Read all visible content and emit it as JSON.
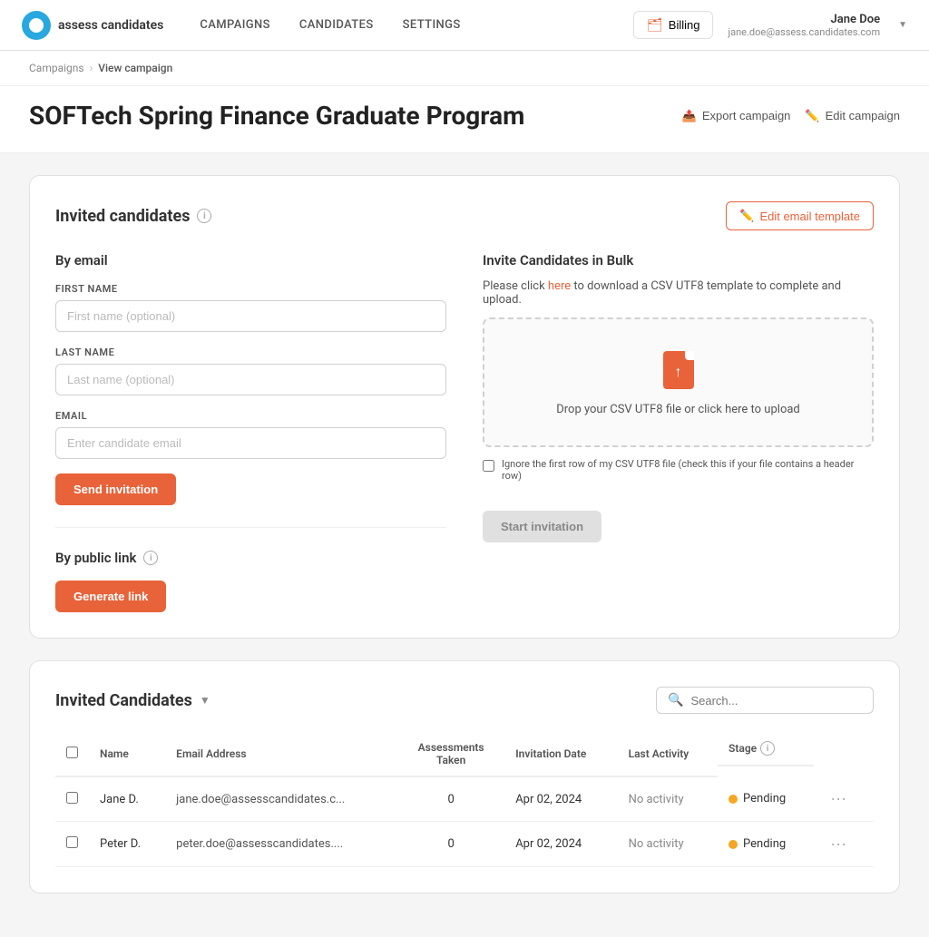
{
  "app": {
    "name": "assess candidates",
    "logo_alt": "assess candidates logo"
  },
  "nav": {
    "links": [
      {
        "label": "CAMPAIGNS",
        "href": "#"
      },
      {
        "label": "CANDIDATES",
        "href": "#"
      },
      {
        "label": "SETTINGS",
        "href": "#"
      }
    ],
    "billing_label": "Billing",
    "user": {
      "name": "Jane Doe",
      "email": "jane.doe@assess.candidates.com"
    }
  },
  "breadcrumb": {
    "parent": "Campaigns",
    "current": "View campaign"
  },
  "page": {
    "title": "SOFTech Spring Finance Graduate Program",
    "export_label": "Export campaign",
    "edit_label": "Edit campaign"
  },
  "invite_section": {
    "title": "Invited candidates",
    "edit_template_label": "Edit email template",
    "by_email": {
      "title": "By email",
      "first_name_label": "FIRST NAME",
      "first_name_placeholder": "First name (optional)",
      "last_name_label": "LAST NAME",
      "last_name_placeholder": "Last name (optional)",
      "email_label": "EMAIL",
      "email_placeholder": "Enter candidate email",
      "send_btn": "Send invitation"
    },
    "bulk": {
      "title": "Invite Candidates in Bulk",
      "note_prefix": "Please click ",
      "note_link": "here",
      "note_suffix": " to download a CSV UTF8 template to complete and upload.",
      "dropzone_text": "Drop your CSV UTF8 file or click here to upload",
      "ignore_label": "Ignore the first row of my CSV UTF8 file (check this if your file contains a header row)",
      "start_btn": "Start invitation"
    },
    "by_public_link": {
      "title": "By public link",
      "generate_btn": "Generate link"
    }
  },
  "candidates_table": {
    "title": "Invited Candidates",
    "search_placeholder": "Search...",
    "columns": [
      {
        "key": "name",
        "label": "Name"
      },
      {
        "key": "email",
        "label": "Email Address"
      },
      {
        "key": "assessments",
        "label": "Assessments Taken",
        "center": true
      },
      {
        "key": "invitation_date",
        "label": "Invitation Date"
      },
      {
        "key": "last_activity",
        "label": "Last Activity"
      },
      {
        "key": "stage",
        "label": "Stage"
      }
    ],
    "rows": [
      {
        "id": 1,
        "name": "Jane D.",
        "email": "jane.doe@assesscandidates.c...",
        "assessments": "0",
        "invitation_date": "Apr 02, 2024",
        "last_activity": "No activity",
        "stage": "Pending",
        "stage_status": "pending"
      },
      {
        "id": 2,
        "name": "Peter D.",
        "email": "peter.doe@assesscandidates....",
        "assessments": "0",
        "invitation_date": "Apr 02, 2024",
        "last_activity": "No activity",
        "stage": "Pending",
        "stage_status": "pending"
      }
    ]
  }
}
